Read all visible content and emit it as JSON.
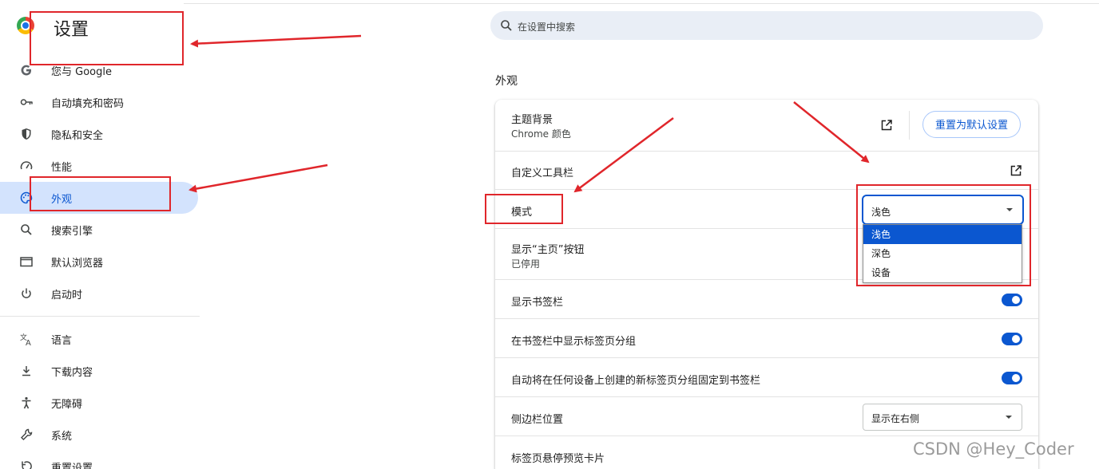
{
  "header": {
    "title": "设置"
  },
  "search": {
    "placeholder": "在设置中搜索"
  },
  "sidebar": {
    "items": [
      {
        "label": "您与 Google",
        "icon": "google-icon"
      },
      {
        "label": "自动填充和密码",
        "icon": "key-icon"
      },
      {
        "label": "隐私和安全",
        "icon": "shield-icon"
      },
      {
        "label": "性能",
        "icon": "speedometer-icon"
      },
      {
        "label": "外观",
        "icon": "palette-icon",
        "active": true
      },
      {
        "label": "搜索引擎",
        "icon": "search-icon"
      },
      {
        "label": "默认浏览器",
        "icon": "browser-window-icon"
      },
      {
        "label": "启动时",
        "icon": "power-icon"
      },
      {
        "label": "语言",
        "icon": "translate-icon"
      },
      {
        "label": "下载内容",
        "icon": "download-icon"
      },
      {
        "label": "无障碍",
        "icon": "accessibility-icon"
      },
      {
        "label": "系统",
        "icon": "wrench-icon"
      },
      {
        "label": "重置设置",
        "icon": "reset-icon"
      }
    ]
  },
  "appearance": {
    "section_title": "外观",
    "theme": {
      "label": "主题背景",
      "sub": "Chrome 颜色",
      "reset_label": "重置为默认设置"
    },
    "toolbar": {
      "label": "自定义工具栏"
    },
    "mode": {
      "label": "模式",
      "value": "浅色",
      "options": [
        "浅色",
        "深色",
        "设备"
      ],
      "selected_index": 0
    },
    "home_button": {
      "label": "显示“主页”按钮",
      "sub": "已停用"
    },
    "bookmarks_bar": {
      "label": "显示书签栏",
      "enabled": true
    },
    "tab_groups": {
      "label": "在书签栏中显示标签页分组",
      "enabled": true
    },
    "auto_pin": {
      "label": "自动将在任何设备上创建的新标签页分组固定到书签栏",
      "enabled": true
    },
    "sidebar_position": {
      "label": "侧边栏位置",
      "value": "显示在右侧"
    },
    "hover_card": {
      "label": "标签页悬停预览卡片"
    }
  },
  "watermark": "CSDN @Hey_Coder",
  "colors": {
    "accent": "#0b57d0",
    "active_bg": "#d3e3fd",
    "annotation": "#e0262b"
  }
}
